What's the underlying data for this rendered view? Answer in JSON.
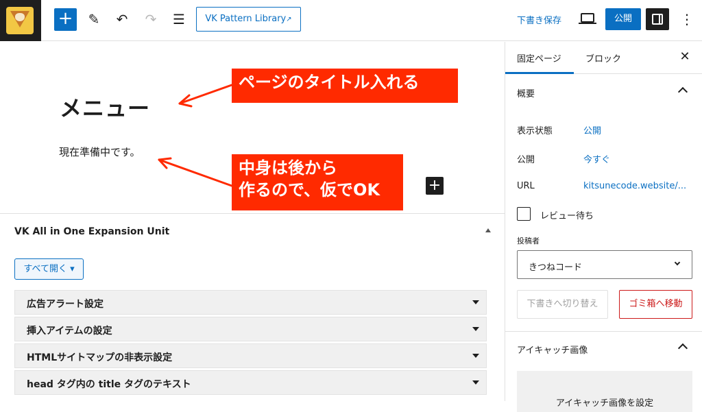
{
  "toolbar": {
    "logo_icon": "fox-logo-icon",
    "add_icon": "+",
    "pencil_icon": "✎",
    "undo_icon": "↶",
    "redo_icon": "↷",
    "list_view_icon": "☰",
    "pattern_library_label": "VK Pattern Library",
    "external_icon": "↗",
    "save_draft_label": "下書き保存",
    "publish_label": "公開",
    "more_icon": "⋮"
  },
  "editor": {
    "title": "メニュー",
    "paragraph": "現在準備中です。",
    "inline_add_icon": "+",
    "callouts": [
      "ページのタイトル入れる",
      "中身は後から",
      "作るので、仮でOK"
    ]
  },
  "meta_box": {
    "title": "VK All in One Expansion Unit",
    "open_all_label": "すべて開く",
    "open_all_caret": "▾",
    "items": [
      "広告アラート設定",
      "挿入アイテムの設定",
      "HTMLサイトマップの非表示設定",
      "head タグ内の title タグのテキスト"
    ]
  },
  "sidebar": {
    "tabs": [
      "固定ページ",
      "ブロック"
    ],
    "close_icon": "✕",
    "summary_title": "概要",
    "rows": [
      {
        "label": "表示状態",
        "value": "公開"
      },
      {
        "label": "公開",
        "value": "今すぐ"
      },
      {
        "label": "URL",
        "value": "kitsunecode.website/..."
      }
    ],
    "pending_review_label": "レビュー待ち",
    "author_label": "投稿者",
    "author_value": "きつねコード",
    "switch_draft_label": "下書きへ切り替え",
    "trash_label": "ゴミ箱へ移動",
    "featured_image_title": "アイキャッチ画像",
    "featured_image_button": "アイキャッチ画像を設定"
  },
  "colors": {
    "accent": "#0a6fc2",
    "callout": "#ff2a00",
    "danger": "#cc1818"
  }
}
